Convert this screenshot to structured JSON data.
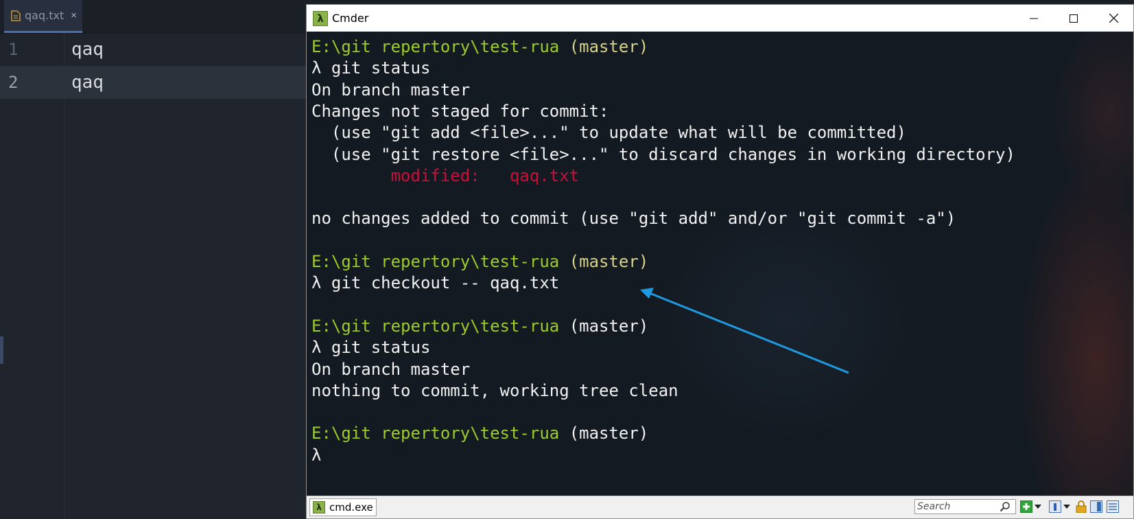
{
  "editor": {
    "tab": {
      "label": "qaq.txt",
      "close": "×"
    },
    "lines": [
      {
        "num": "1",
        "text": "qaq"
      },
      {
        "num": "2",
        "text": "qaq"
      }
    ]
  },
  "cmder": {
    "title": "Cmder",
    "app_icon": "λ",
    "console": {
      "lines": [
        {
          "segments": [
            {
              "t": "E:\\git repertory\\test-rua ",
              "c": "green"
            },
            {
              "t": "(master)",
              "c": "yellow"
            }
          ]
        },
        {
          "segments": [
            {
              "t": "λ git status",
              "c": "white"
            }
          ]
        },
        {
          "segments": [
            {
              "t": "On branch master",
              "c": "white"
            }
          ]
        },
        {
          "segments": [
            {
              "t": "Changes not staged for commit:",
              "c": "white"
            }
          ]
        },
        {
          "segments": [
            {
              "t": "  (use \"git add <file>...\" to update what will be committed)",
              "c": "white"
            }
          ]
        },
        {
          "segments": [
            {
              "t": "  (use \"git restore <file>...\" to discard changes in working directory)",
              "c": "white"
            }
          ]
        },
        {
          "segments": [
            {
              "t": "        modified:   qaq.txt",
              "c": "red"
            }
          ]
        },
        {
          "segments": [
            {
              "t": "",
              "c": "white"
            }
          ]
        },
        {
          "segments": [
            {
              "t": "no changes added to commit (use \"git add\" and/or \"git commit -a\")",
              "c": "white"
            }
          ]
        },
        {
          "segments": [
            {
              "t": "",
              "c": "white"
            }
          ]
        },
        {
          "segments": [
            {
              "t": "E:\\git repertory\\test-rua ",
              "c": "green"
            },
            {
              "t": "(master)",
              "c": "yellow"
            }
          ]
        },
        {
          "segments": [
            {
              "t": "λ git checkout -- qaq.txt",
              "c": "white"
            }
          ]
        },
        {
          "segments": [
            {
              "t": "",
              "c": "white"
            }
          ]
        },
        {
          "segments": [
            {
              "t": "E:\\git repertory\\test-rua ",
              "c": "green"
            },
            {
              "t": "(master)",
              "c": "white"
            }
          ]
        },
        {
          "segments": [
            {
              "t": "λ git status",
              "c": "white"
            }
          ]
        },
        {
          "segments": [
            {
              "t": "On branch master",
              "c": "white"
            }
          ]
        },
        {
          "segments": [
            {
              "t": "nothing to commit, working tree clean",
              "c": "white"
            }
          ]
        },
        {
          "segments": [
            {
              "t": "",
              "c": "white"
            }
          ]
        },
        {
          "segments": [
            {
              "t": "E:\\git repertory\\test-rua ",
              "c": "green"
            },
            {
              "t": "(master)",
              "c": "white"
            }
          ]
        },
        {
          "segments": [
            {
              "t": "λ",
              "c": "white"
            }
          ]
        }
      ]
    },
    "statusbar": {
      "console_tab": {
        "icon": "λ",
        "label": "cmd.exe"
      },
      "search": {
        "placeholder": "Search"
      }
    }
  },
  "colors": {
    "prompt_path": "#9ccc2a",
    "branch": "#d6d28a",
    "modified": "#c8103a",
    "arrow": "#1e9be0"
  }
}
